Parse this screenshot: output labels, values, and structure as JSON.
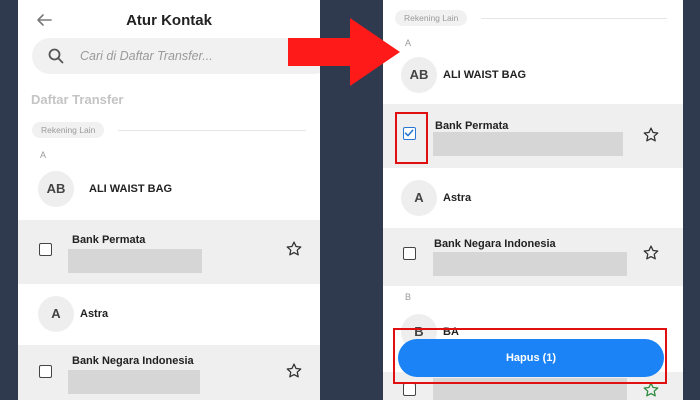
{
  "left_screen": {
    "title": "Atur Kontak",
    "search_placeholder": "Cari di Daftar Transfer...",
    "section_title": "Daftar Transfer",
    "tag": "Rekening Lain",
    "group_letter": "A",
    "contacts": [
      {
        "initials": "AB",
        "name": "ALI WAIST BAG"
      },
      {
        "name": "Bank Permata",
        "checked": false
      },
      {
        "initials": "A",
        "name": "Astra"
      },
      {
        "name": "Bank Negara Indonesia",
        "checked": false
      }
    ]
  },
  "right_screen": {
    "tag": "Rekening Lain",
    "group_letter_a": "A",
    "group_letter_b": "B",
    "contacts": [
      {
        "initials": "AB",
        "name": "ALI WAIST BAG"
      },
      {
        "name": "Bank Permata",
        "checked": true
      },
      {
        "initials": "A",
        "name": "Astra"
      },
      {
        "name": "Bank Negara Indonesia",
        "checked": false
      },
      {
        "initials": "B",
        "name": "BA"
      }
    ],
    "delete_button_label": "Hapus (1)"
  },
  "colors": {
    "accent_blue": "#1b83f5",
    "highlight_red": "#e01010",
    "arrow_red": "#ff1a1a"
  }
}
